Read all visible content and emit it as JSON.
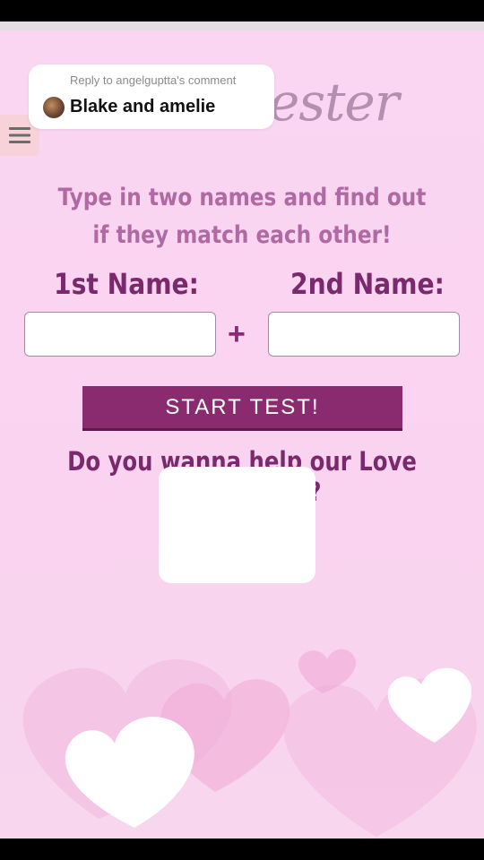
{
  "page": {
    "logo_partial": "ester",
    "intro": "Type in two names and find out if they match each other!",
    "first_name_label": "1st Name:",
    "second_name_label": "2nd Name:",
    "first_name_value": "",
    "second_name_value": "",
    "plus_sign": "+",
    "start_button": "START TEST!",
    "help_text": "Do you wanna help our Love Tester-Team?"
  },
  "comment": {
    "reply_text": "Reply to angelguptta's comment",
    "comment_text": "Blake and amelie"
  },
  "colors": {
    "background": "#fbd6f2",
    "accent": "#8a2a6f",
    "label": "#7a2a6c",
    "intro": "#b06aa3"
  }
}
